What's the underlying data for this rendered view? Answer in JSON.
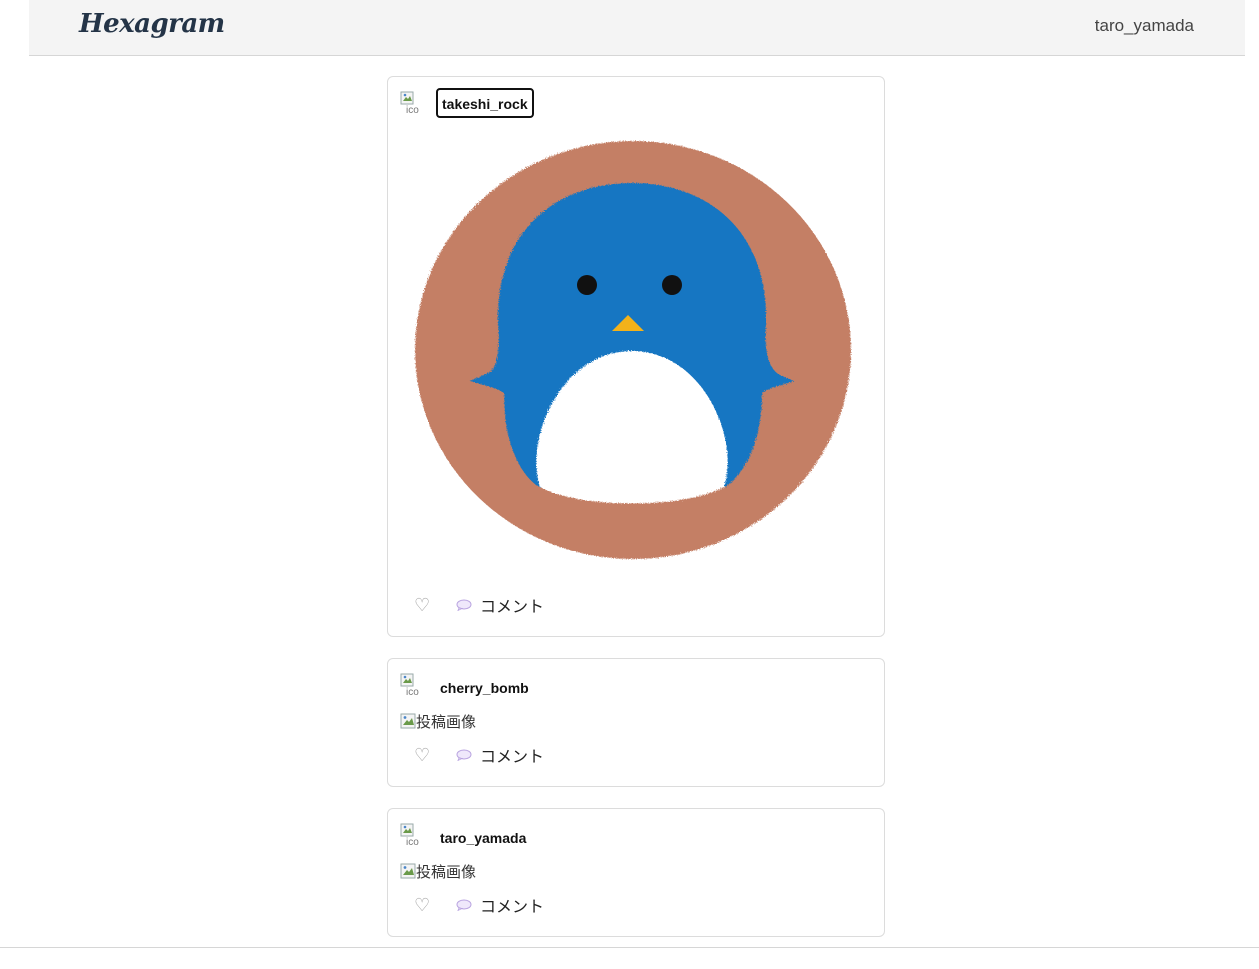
{
  "navbar": {
    "brand": "Hexagram",
    "current_user": "taro_yamada"
  },
  "posts": [
    {
      "username": "takeshi_rock",
      "avatar_alt": "ico",
      "image": "penguin-illustration",
      "image_alt": "",
      "comment_label": "コメント"
    },
    {
      "username": "cherry_bomb",
      "avatar_alt": "ico",
      "image": "broken",
      "image_alt": "投稿画像",
      "comment_label": "コメント"
    },
    {
      "username": "taro_yamada",
      "avatar_alt": "ico",
      "image": "broken",
      "image_alt": "投稿画像",
      "comment_label": "コメント"
    }
  ],
  "icons": {
    "like": "heart-outline-icon",
    "comment": "speech-bubble-icon",
    "broken_image": "broken-image-icon"
  },
  "colors": {
    "brand": "#243447",
    "navbar_bg": "#f4f4f4",
    "penguin_blue": "#1276c2",
    "penguin_ring": "#c47f65",
    "beak": "#f3b21a"
  }
}
